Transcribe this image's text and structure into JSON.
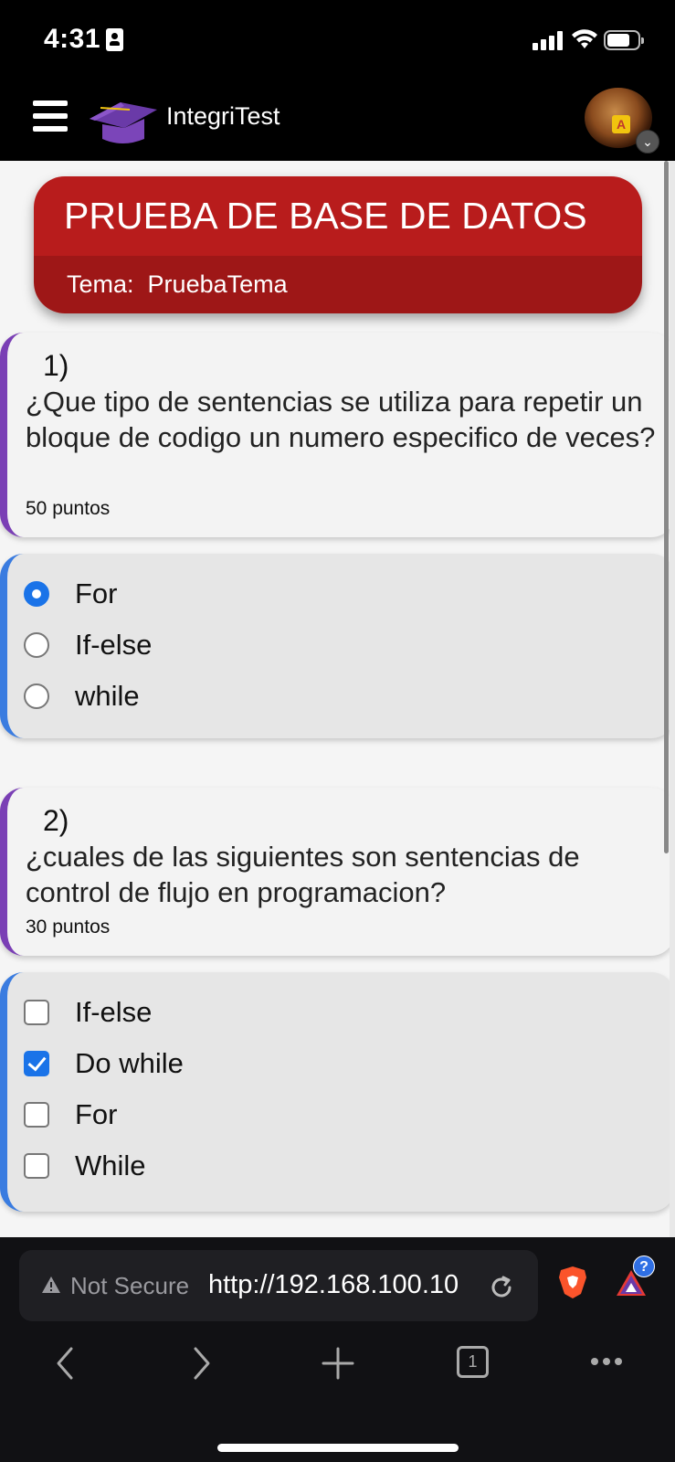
{
  "status": {
    "time": "4:31"
  },
  "header": {
    "app_name": "IntegriTest"
  },
  "banner": {
    "title": "PRUEBA DE BASE DE DATOS",
    "topic_label": "Tema:",
    "topic_value": "PruebaTema"
  },
  "questions": [
    {
      "number": "1)",
      "text": "¿Que tipo de sentencias se utiliza para repetir un bloque de codigo un numero especifico de veces?",
      "points": "50 puntos",
      "type": "radio",
      "options": [
        {
          "label": "For",
          "checked": true
        },
        {
          "label": "If-else",
          "checked": false
        },
        {
          "label": "while",
          "checked": false
        }
      ]
    },
    {
      "number": "2)",
      "text": "¿cuales de las siguientes son sentencias de control de flujo en programacion?",
      "points": "30 puntos",
      "type": "checkbox",
      "options": [
        {
          "label": "If-else",
          "checked": false
        },
        {
          "label": "Do while",
          "checked": true
        },
        {
          "label": "For",
          "checked": false
        },
        {
          "label": "While",
          "checked": false
        }
      ]
    }
  ],
  "browser": {
    "security_label": "Not Secure",
    "url": "http://192.168.100.10",
    "tabs_count": "1",
    "rewards_badge": "?"
  },
  "colors": {
    "banner_red": "#b81c1c",
    "question_accent": "#7a3fb5",
    "options_accent": "#3a7ce0",
    "selection_blue": "#1a73e8"
  }
}
